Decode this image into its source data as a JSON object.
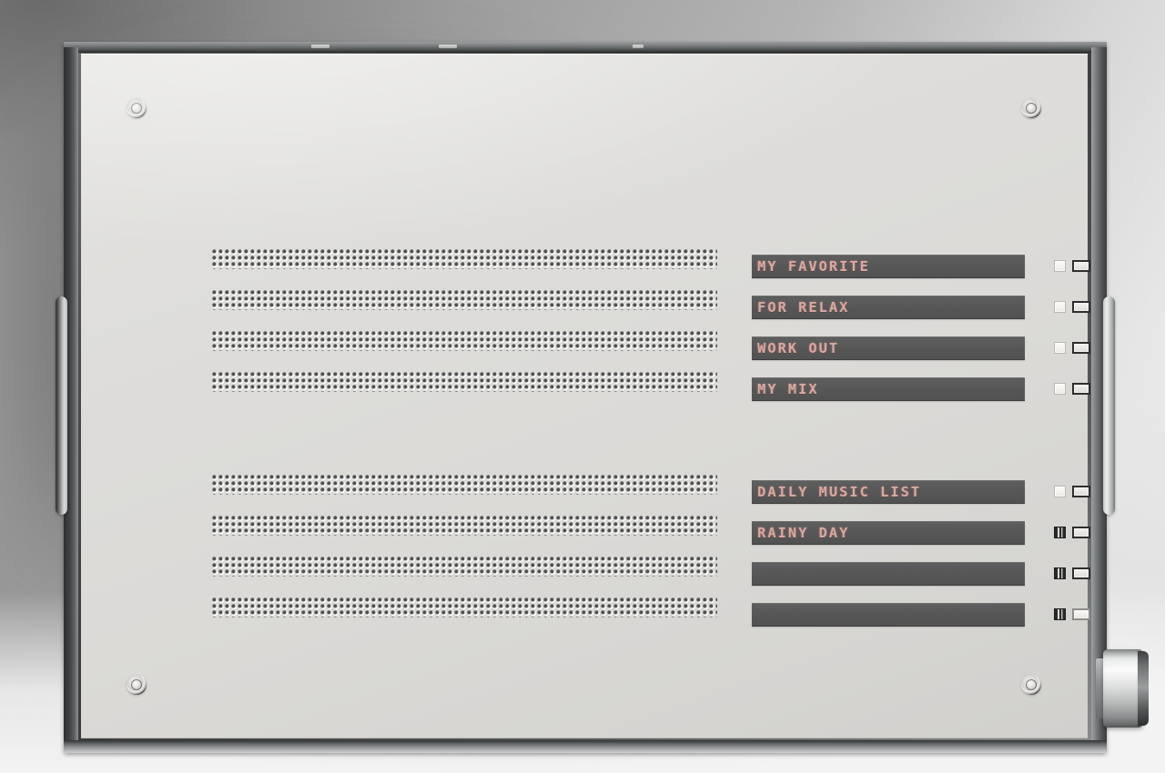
{
  "device": {
    "name": "music-player-panel",
    "colors": {
      "faceplate": "#dedddb",
      "frame": "#4a4c4d",
      "bar_background": "#585858",
      "led_text": "#d9a9a1",
      "background": "#b4b4b4"
    }
  },
  "groups": [
    {
      "id": "playlist-group-1",
      "rows": [
        {
          "label": "MY FAVORITE",
          "indicator_left": "off",
          "indicator_right": "dark"
        },
        {
          "label": "FOR RELAX",
          "indicator_left": "off",
          "indicator_right": "dark"
        },
        {
          "label": "WORK OUT",
          "indicator_left": "off",
          "indicator_right": "dark"
        },
        {
          "label": "MY MIX",
          "indicator_left": "off",
          "indicator_right": "dark"
        }
      ]
    },
    {
      "id": "playlist-group-2",
      "rows": [
        {
          "label": "DAILY MUSIC LIST",
          "indicator_left": "off",
          "indicator_right": "dark"
        },
        {
          "label": "RAINY DAY",
          "indicator_left": "on",
          "indicator_right": "dark"
        },
        {
          "label": "",
          "indicator_left": "on",
          "indicator_right": "dark"
        },
        {
          "label": "",
          "indicator_left": "on",
          "indicator_right": "light"
        }
      ]
    }
  ],
  "hardware": {
    "screws": [
      "screw-top-left",
      "screw-top-right",
      "screw-bottom-left",
      "screw-bottom-right"
    ],
    "handles": [
      "handle-left",
      "handle-right"
    ],
    "knob": "rotary-knob-right",
    "grille_bands": 8
  }
}
